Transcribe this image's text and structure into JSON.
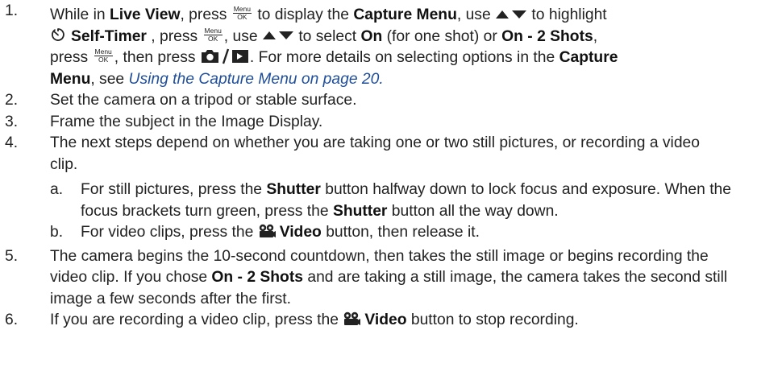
{
  "steps": {
    "s1": {
      "number": "1.",
      "t1": "While in ",
      "live_view": "Live View",
      "t2": ", press ",
      "btn_menu": "Menu",
      "btn_ok": "OK",
      "t3": " to display the ",
      "capture_menu": "Capture Menu",
      "t4": ", use ",
      "t5": " to highlight",
      "self_timer": "Self-Timer",
      "t6": " , press ",
      "t7": ", use ",
      "t8": " to select ",
      "on": "On",
      "t9": " (for one shot) or ",
      "on_2_shots": "On - 2 Shots",
      "t10": ",",
      "t11": "press ",
      "t12": ", then press ",
      "t13": ". For more details on selecting options in the ",
      "capture": "Capture",
      "menu_word": "Menu",
      "t14": ", see ",
      "link_text": "Using the Capture Menu",
      "t15": " on page 20."
    },
    "s2": {
      "number": "2.",
      "text": "Set the camera on a tripod or stable surface."
    },
    "s3": {
      "number": "3.",
      "text": "Frame the subject in the Image Display."
    },
    "s4": {
      "number": "4.",
      "text": "The next steps depend on whether you are taking one or two still pictures, or recording a video clip.",
      "a": {
        "letter": "a.",
        "t1": "For still pictures, press the ",
        "shutter": "Shutter",
        "t2": " button halfway down to lock focus and exposure. When the focus brackets turn green, press the ",
        "t3": " button all the way down."
      },
      "b": {
        "letter": "b.",
        "t1": "For video clips, press the ",
        "video": "Video",
        "t2": " button, then release it."
      }
    },
    "s5": {
      "number": "5.",
      "t1": "The camera begins the 10-second countdown, then takes the still image or begins recording the video clip. If you chose ",
      "on_2_shots": "On - 2 Shots",
      "t2": " and are taking a still image, the camera takes the second still image a few seconds after the first."
    },
    "s6": {
      "number": "6.",
      "t1": "If you are recording a video clip, press the ",
      "video": "Video",
      "t2": " button to stop recording."
    }
  },
  "colors": {
    "text": "#222222",
    "link": "#1f4e9a"
  },
  "icons": [
    "menu-ok-icon",
    "up-down-arrows-icon",
    "self-timer-icon",
    "camera-playback-icon",
    "video-icon"
  ]
}
